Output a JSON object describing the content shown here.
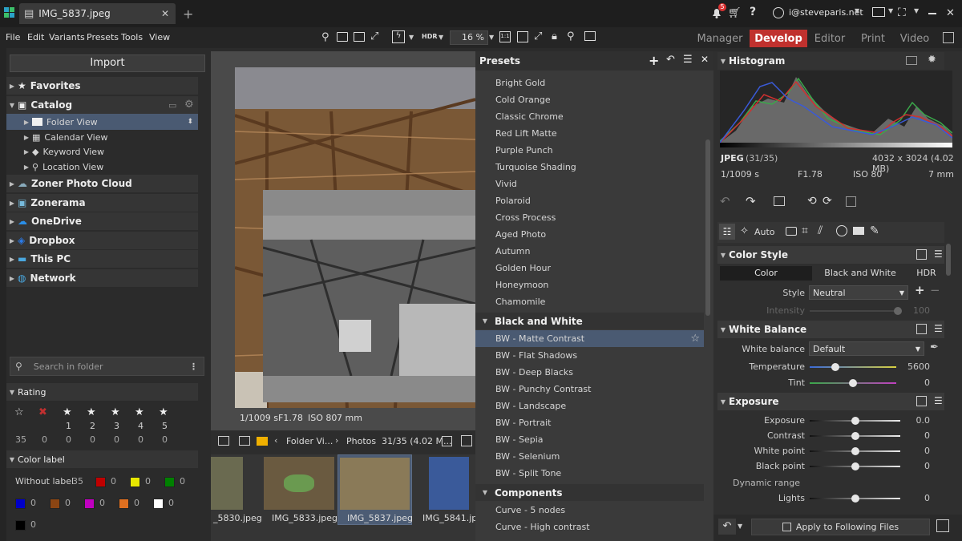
{
  "titlebar": {
    "tab_title": "IMG_5837.jpeg",
    "new_tab": "+",
    "notif_count": "5",
    "user_email": "i@steveparis.net"
  },
  "menu": [
    "File",
    "Edit",
    "Variants",
    "Presets",
    "Tools",
    "View"
  ],
  "toolbar": {
    "zoom": "16 %",
    "hdr": "HDR"
  },
  "modules": [
    "Manager",
    "Develop",
    "Editor",
    "Print",
    "Video"
  ],
  "left": {
    "import": "Import",
    "tree": [
      {
        "label": "Favorites",
        "bold": true
      },
      {
        "label": "Catalog",
        "bold": true
      },
      {
        "label": "Folder View"
      },
      {
        "label": "Calendar View"
      },
      {
        "label": "Keyword View"
      },
      {
        "label": "Location View"
      },
      {
        "label": "Zoner Photo Cloud",
        "bold": true
      },
      {
        "label": "Zonerama",
        "bold": true
      },
      {
        "label": "OneDrive",
        "bold": true
      },
      {
        "label": "Dropbox",
        "bold": true
      },
      {
        "label": "This PC",
        "bold": true
      },
      {
        "label": "Network",
        "bold": true
      }
    ],
    "search_placeholder": "Search in folder",
    "rating_title": "Rating",
    "rating_numbers": [
      "1",
      "2",
      "3",
      "4",
      "5"
    ],
    "rating_counts": [
      "35",
      "0",
      "0",
      "0",
      "0",
      "0",
      "0"
    ],
    "color_label_title": "Color label",
    "without_label": "Without label",
    "without_label_count": "35",
    "color_counts": [
      "0",
      "0",
      "0",
      "0",
      "0",
      "0",
      "0",
      "0",
      "0",
      "0"
    ],
    "colors": [
      "#c00000",
      "#e8e800",
      "#008000",
      "#0000c8",
      "#8b4513",
      "#c000c0",
      "#e07020",
      "#ffffff",
      "#000000"
    ]
  },
  "center": {
    "info": {
      "shutter": "1/1009 s",
      "aperture": "F1.78",
      "iso": "ISO 80",
      "focal": "7 mm"
    },
    "breadcrumb": {
      "folder": "Folder Vi...",
      "photos": "Photos",
      "count": "31/35 (4.02 M..."
    },
    "thumbs": [
      "_5830.jpeg",
      "IMG_5833.jpeg",
      "IMG_5837.jpeg",
      "IMG_5841.jpeg"
    ]
  },
  "presets": {
    "title": "Presets",
    "items1": [
      "Bright Gold",
      "Cold Orange",
      "Classic Chrome",
      "Red Lift Matte",
      "Purple Punch",
      "Turquoise Shading",
      "Vivid",
      "Polaroid",
      "Cross Process",
      "Aged Photo",
      "Autumn",
      "Golden Hour",
      "Honeymoon",
      "Chamomile"
    ],
    "group_bw": "Black and White",
    "items_bw": [
      "BW - Matte Contrast",
      "BW - Flat Shadows",
      "BW - Deep Blacks",
      "BW - Punchy Contrast",
      "BW - Landscape",
      "BW - Portrait",
      "BW - Sepia",
      "BW - Selenium",
      "BW - Split Tone"
    ],
    "group_comp": "Components",
    "items_comp": [
      "Curve - 5 nodes",
      "Curve - High contrast"
    ]
  },
  "right": {
    "histogram_title": "Histogram",
    "file_type": "JPEG",
    "file_index": "(31/35)",
    "dims": "4032 x 3024 (4.02 MB)",
    "shutter": "1/1009 s",
    "aperture": "F1.78",
    "iso": "ISO 80",
    "focal": "7 mm",
    "auto": "Auto",
    "color_style": "Color Style",
    "cs_tabs": [
      "Color",
      "Black and White",
      "HDR"
    ],
    "style_label": "Style",
    "style_value": "Neutral",
    "intensity_label": "Intensity",
    "intensity_value": "100",
    "wb_title": "White Balance",
    "wb_label": "White balance",
    "wb_value": "Default",
    "temp_label": "Temperature",
    "temp_value": "5600",
    "tint_label": "Tint",
    "tint_value": "0",
    "exposure_title": "Exposure",
    "exp_rows": [
      {
        "label": "Exposure",
        "value": "0.0"
      },
      {
        "label": "Contrast",
        "value": "0"
      },
      {
        "label": "White point",
        "value": "0"
      },
      {
        "label": "Black point",
        "value": "0"
      }
    ],
    "dynamic_range": "Dynamic range",
    "lights_label": "Lights",
    "lights_value": "0",
    "apply": "Apply to Following Files"
  }
}
